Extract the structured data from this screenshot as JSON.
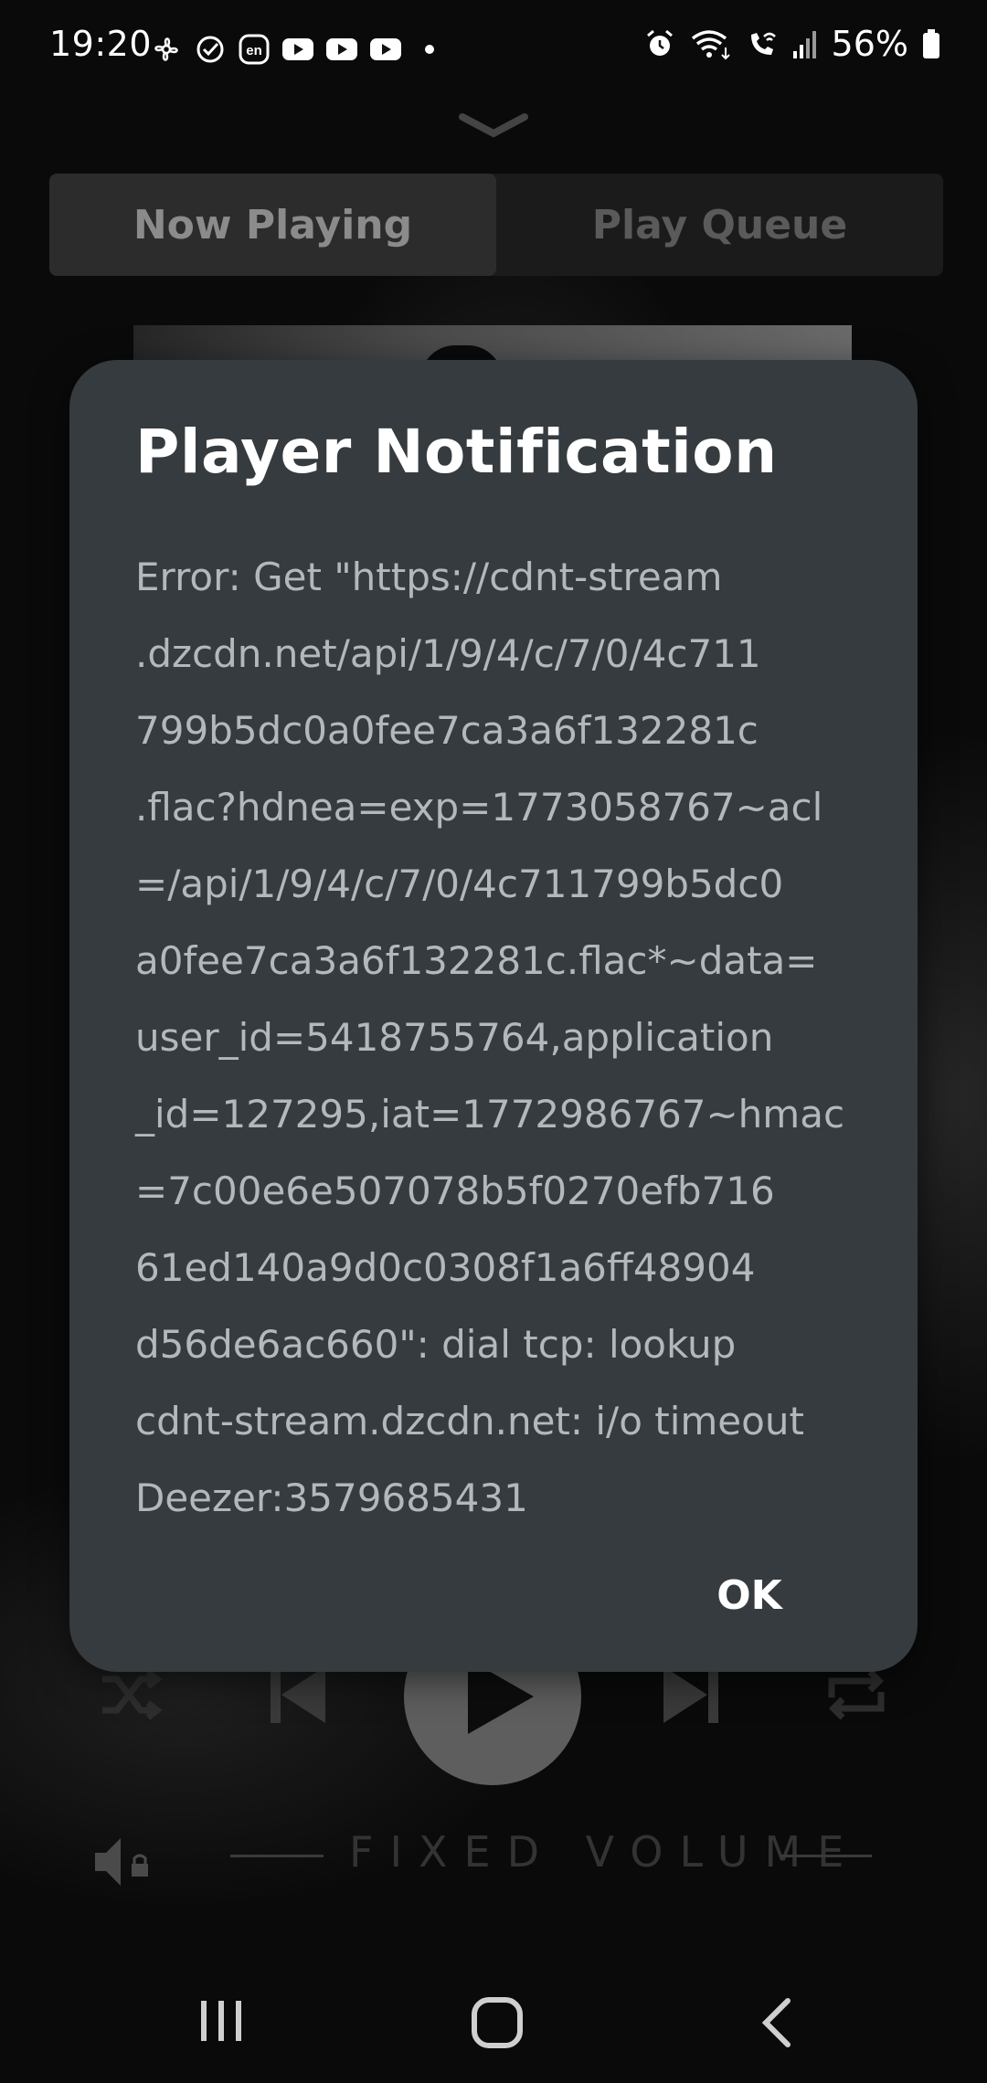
{
  "status_bar": {
    "time": "19:20",
    "battery_percent": "56%",
    "left_icons": [
      "fan-icon",
      "check-circle-icon",
      "en-keyboard-icon",
      "youtube-icon",
      "youtube-icon",
      "youtube-icon",
      "dot-icon"
    ],
    "right_icons": [
      "alarm-icon",
      "wifi-icon",
      "wifi-call-icon",
      "signal-icon",
      "battery-icon"
    ]
  },
  "player": {
    "tabs": [
      {
        "label": "Now Playing",
        "active": true
      },
      {
        "label": "Play Queue",
        "active": false
      }
    ],
    "controls": [
      "shuffle-icon",
      "previous-icon",
      "play-icon",
      "next-icon",
      "repeat-icon"
    ],
    "volume_label": "FIXED VOLUME"
  },
  "dialog": {
    "title": "Player Notification",
    "message_lines": [
      "Error: Get \"https://cdnt-stream",
      ".dzcdn.net/api/1/9/4/c/7/0/4c711",
      "799b5dc0a0fee7ca3a6f132281c",
      ".flac?hdnea=exp=1773058767~acl",
      "=/api/1/9/4/c/7/0/4c711799b5dc0",
      "a0fee7ca3a6f132281c.flac*~data=",
      "user_id=5418755764,application",
      "_id=127295,iat=1772986767~hmac",
      "=7c00e6e507078b5f0270efb716",
      "61ed140a9d0c0308f1a6ff48904",
      "d56de6ac660\": dial tcp: lookup",
      "cdnt-stream.dzcdn.net: i/o timeout",
      "Deezer:3579685431"
    ],
    "ok_label": "OK"
  },
  "colors": {
    "dialog_bg": "#353b3e",
    "title": "#ffffff",
    "message": "#b3b8bb",
    "background": "#0a0a0a"
  }
}
